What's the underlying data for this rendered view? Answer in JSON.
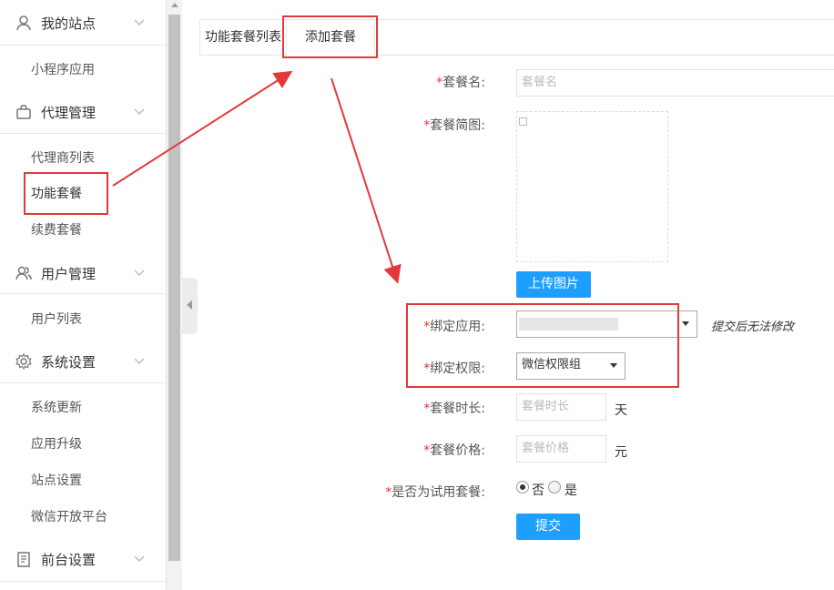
{
  "sidebar": {
    "groups": [
      {
        "label": "我的站点",
        "icon": "user-icon"
      },
      {
        "label": "代理管理",
        "icon": "bag-icon"
      },
      {
        "label": "用户管理",
        "icon": "users-icon"
      },
      {
        "label": "系统设置",
        "icon": "gear-icon"
      },
      {
        "label": "前台设置",
        "icon": "document-icon"
      }
    ],
    "items": {
      "miniapp": "小程序应用",
      "agent_list": "代理商列表",
      "func_package": "功能套餐",
      "renew_package": "续费套餐",
      "user_list": "用户列表",
      "sys_update": "系统更新",
      "app_upgrade": "应用升级",
      "site_settings": "站点设置",
      "wechat_open": "微信开放平台"
    }
  },
  "tabs": {
    "list": "功能套餐列表",
    "add": "添加套餐"
  },
  "form": {
    "required_mark": "*",
    "name_label": "套餐名:",
    "name_placeholder": "套餐名",
    "image_label": "套餐简图:",
    "upload_button": "上传图片",
    "bind_app_label": "绑定应用:",
    "bind_app_note": "提交后无法修改",
    "bind_perm_label": "绑定权限:",
    "bind_perm_value": "微信权限组",
    "duration_label": "套餐时长:",
    "duration_placeholder": "套餐时长",
    "duration_unit": "天",
    "price_label": "套餐价格:",
    "price_placeholder": "套餐价格",
    "price_unit": "元",
    "trial_label": "是否为试用套餐:",
    "trial_no": "否",
    "trial_yes": "是",
    "trial_selected": "否",
    "submit": "提交"
  },
  "colors": {
    "accent": "#1e9fff",
    "annotation": "#e23a3a",
    "required": "#ee3333"
  }
}
